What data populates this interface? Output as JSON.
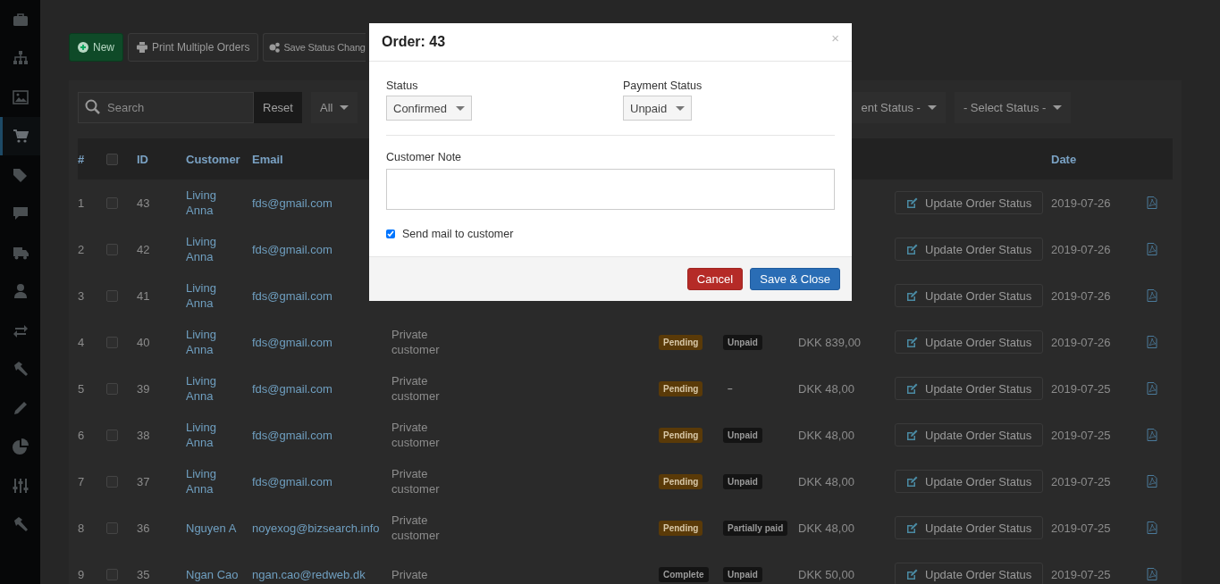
{
  "sidebar": {
    "items": [
      {
        "selected": false
      },
      {
        "selected": false
      },
      {
        "selected": false
      },
      {
        "selected": true
      },
      {
        "selected": false
      },
      {
        "selected": false
      },
      {
        "selected": false
      },
      {
        "selected": false
      },
      {
        "selected": false
      },
      {
        "selected": false
      },
      {
        "selected": false
      },
      {
        "selected": false
      },
      {
        "selected": false
      },
      {
        "selected": false
      }
    ]
  },
  "toolbar": {
    "buttons": [
      {
        "label": "New",
        "kind": "new"
      },
      {
        "label": "Print Multiple Orders",
        "kind": "print"
      },
      {
        "label": "Save Status Chang",
        "kind": "settings"
      }
    ]
  },
  "filters": {
    "search": {
      "placeholder": "Search"
    },
    "reset": "Reset",
    "dropdowns": [
      "All",
      "ent Status -",
      "- Select Status -"
    ]
  },
  "table": {
    "columns": [
      "#",
      "ID",
      "Customer",
      "Email",
      "Date"
    ],
    "select_all": {
      "checked": false
    },
    "rows": [
      {
        "index": "1",
        "checked": false,
        "id": "43",
        "customer": "Living Anna",
        "email": "fds@gmail.com",
        "action": "Update Order Status",
        "date": "2019-07-26"
      },
      {
        "index": "2",
        "checked": false,
        "id": "42",
        "customer": "Living Anna",
        "email": "fds@gmail.com",
        "action": "Update Order Status",
        "date": "2019-07-26"
      },
      {
        "index": "3",
        "checked": false,
        "id": "41",
        "customer": "Living Anna",
        "email": "fds@gmail.com",
        "action": "Update Order Status",
        "date": "2019-07-26"
      },
      {
        "index": "4",
        "checked": false,
        "id": "40",
        "customer": "Living Anna",
        "email": "fds@gmail.com",
        "customer_type": "Private customer",
        "status": {
          "label": "Pending",
          "kind": "pending"
        },
        "payment": {
          "label": "Unpaid",
          "kind": "unpaid"
        },
        "amount": "DKK 839,00",
        "action": "Update Order Status",
        "date": "2019-07-26"
      },
      {
        "index": "5",
        "checked": false,
        "id": "39",
        "customer": "Living Anna",
        "email": "fds@gmail.com",
        "customer_type": "Private customer",
        "status": {
          "label": "Pending",
          "kind": "pending"
        },
        "payment": {
          "label": "–",
          "kind": "none"
        },
        "amount": "DKK 48,00",
        "action": "Update Order Status",
        "date": "2019-07-25"
      },
      {
        "index": "6",
        "checked": false,
        "id": "38",
        "customer": "Living Anna",
        "email": "fds@gmail.com",
        "customer_type": "Private customer",
        "status": {
          "label": "Pending",
          "kind": "pending"
        },
        "payment": {
          "label": "Unpaid",
          "kind": "unpaid"
        },
        "amount": "DKK 48,00",
        "action": "Update Order Status",
        "date": "2019-07-25"
      },
      {
        "index": "7",
        "checked": false,
        "id": "37",
        "customer": "Living Anna",
        "email": "fds@gmail.com",
        "customer_type": "Private customer",
        "status": {
          "label": "Pending",
          "kind": "pending"
        },
        "payment": {
          "label": "Unpaid",
          "kind": "unpaid"
        },
        "amount": "DKK 48,00",
        "action": "Update Order Status",
        "date": "2019-07-25"
      },
      {
        "index": "8",
        "checked": false,
        "id": "36",
        "customer": "Nguyen A",
        "email": "noyexog@bizsearch.info",
        "customer_type": "Private customer",
        "status": {
          "label": "Pending",
          "kind": "pending"
        },
        "payment": {
          "label": "Partially paid",
          "kind": "partial"
        },
        "amount": "DKK 48,00",
        "action": "Update Order Status",
        "date": "2019-07-25"
      },
      {
        "index": "9",
        "checked": false,
        "id": "35",
        "customer": "Ngan Cao",
        "email": "ngan.cao@redweb.dk",
        "customer_type": "Private",
        "status": {
          "label": "Complete",
          "kind": "complete"
        },
        "payment": {
          "label": "Unpaid",
          "kind": "unpaid"
        },
        "amount": "DKK 50,00",
        "action": "Update Order Status",
        "date": "2019-07-25"
      }
    ]
  },
  "modal": {
    "title": "Order: 43",
    "close": "×",
    "fields": [
      {
        "label": "Status",
        "value": "Confirmed"
      },
      {
        "label": "Payment Status",
        "value": "Unpaid"
      }
    ],
    "note": {
      "label": "Customer Note"
    },
    "send_mail": {
      "label": "Send mail to customer",
      "checked": true
    },
    "buttons": [
      {
        "label": "Cancel",
        "kind": "danger"
      },
      {
        "label": "Save & Close",
        "kind": "primary"
      }
    ]
  }
}
